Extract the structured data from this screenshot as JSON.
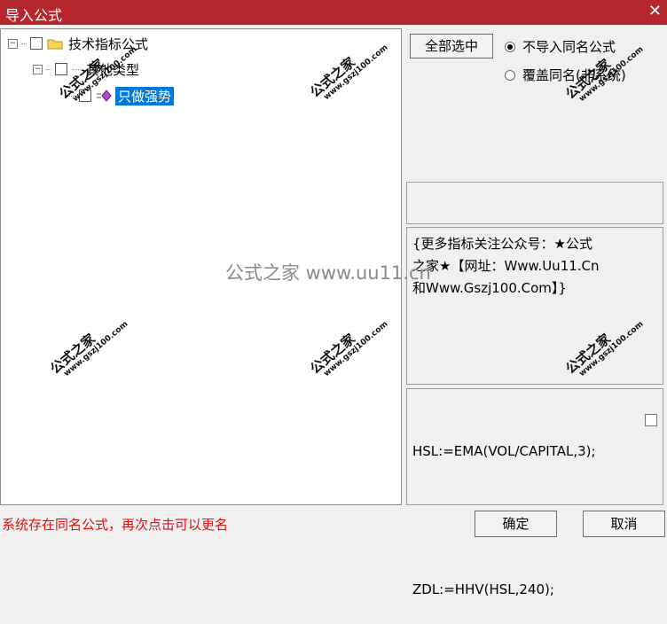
{
  "window": {
    "title": "导入公式",
    "close_glyph": "✕"
  },
  "tree": {
    "expander_glyph": "−",
    "root": {
      "label": "技术指标公式"
    },
    "category": {
      "label": "其他类型"
    },
    "formula": {
      "label": "只做强势"
    }
  },
  "options": {
    "select_all_label": "全部选中",
    "radio_skip_label": "不导入同名公式",
    "radio_overwrite_label": "覆盖同名(非系统)",
    "selected": "radio_skip"
  },
  "description": {
    "lines": [
      "{更多指标关注公众号：★公式",
      "之家★【网址：Www.Uu11.Cn",
      "和Www.Gszj100.Com】}"
    ]
  },
  "code": {
    "lines": [
      "HSL:=EMA(VOL/CAPITAL,3);",
      "",
      "ZDL:=HHV(HSL,240);"
    ]
  },
  "status": {
    "message": "系统存在同名公式，再次点击可以更名",
    "color": "#e01010"
  },
  "buttons": {
    "ok_label": "确定",
    "cancel_label": "取消"
  },
  "watermark": {
    "cn": "公式之家",
    "url": "www.gszj100.com",
    "center_text": "公式之家 www.uu11.cn"
  },
  "colors": {
    "titlebar": "#b5262d",
    "selection": "#0078d7"
  }
}
